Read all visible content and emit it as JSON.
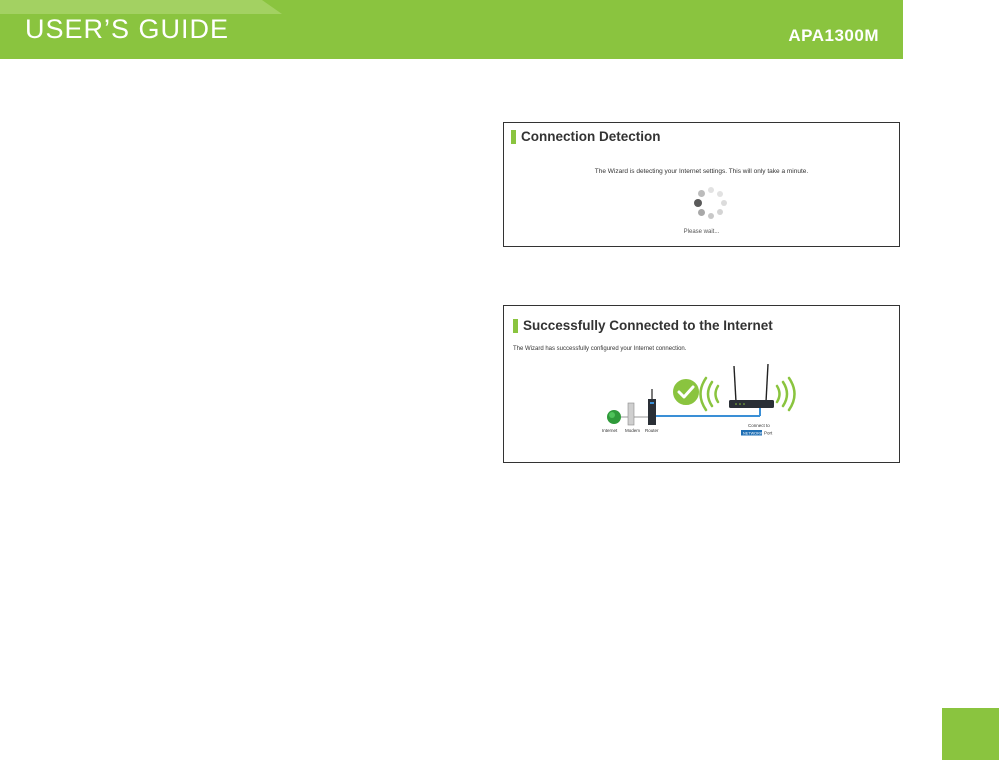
{
  "header": {
    "guide_title": "USER’S GUIDE",
    "model": "APA1300M",
    "colors": {
      "band": "#8ac43f",
      "band_light": "#a3d162"
    }
  },
  "screenshots": [
    {
      "title": "Connection Detection",
      "message": "The Wizard is detecting your Internet settings. This will only take a minute.",
      "status": "Please wait...",
      "icon": "loading-spinner-icon"
    },
    {
      "title": "Successfully Connected to the Internet",
      "message": "The Wizard has successfully configured your Internet connection.",
      "labels": {
        "internet": "Internet",
        "modem": "Modem",
        "router": "Router",
        "connect_to": "Connect to",
        "network": "NETWORK",
        "port": "Port"
      },
      "icons": [
        "globe-icon",
        "modem-icon",
        "router-icon",
        "checkmark-icon",
        "wifi-waves-icon",
        "access-point-icon"
      ]
    }
  ]
}
